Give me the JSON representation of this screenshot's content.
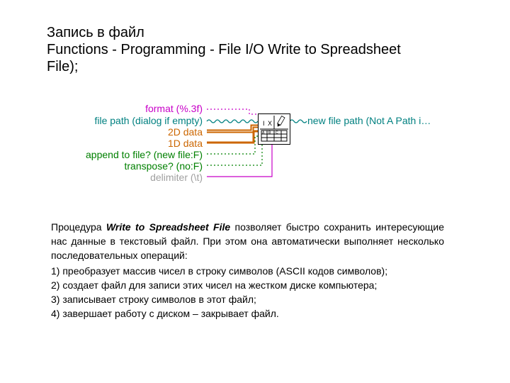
{
  "header": {
    "line1": "Запись в файл",
    "line2": "Functions - Programming - File I/O Write to Spreadsheet File);"
  },
  "diagram": {
    "format": "format (%.3f)",
    "filepath": "file path (dialog if empty)",
    "d2": "2D data",
    "d1": "1D data",
    "append": "append to file? (new file:F)",
    "transpose": "transpose? (no:F)",
    "delimiter": "delimiter (\\t)",
    "newpath": "new file path (Not A Path i…"
  },
  "body": {
    "intro": "Процедура Write to Spreadsheet File позволяет быстро сохранить интересующие нас данные в текстовый файл. При этом она автоматически выполняет несколько последовательных операций:",
    "s1": "1) преобразует массив чисел в строку символов (ASCII кодов символов);",
    "s2": "2) создает файл для записи этих чисел на жестком диске компьютера;",
    "s3": "3) записывает строку символов в этот файл;",
    "s4": "4) завершает работу с диском – закрывает файл."
  }
}
